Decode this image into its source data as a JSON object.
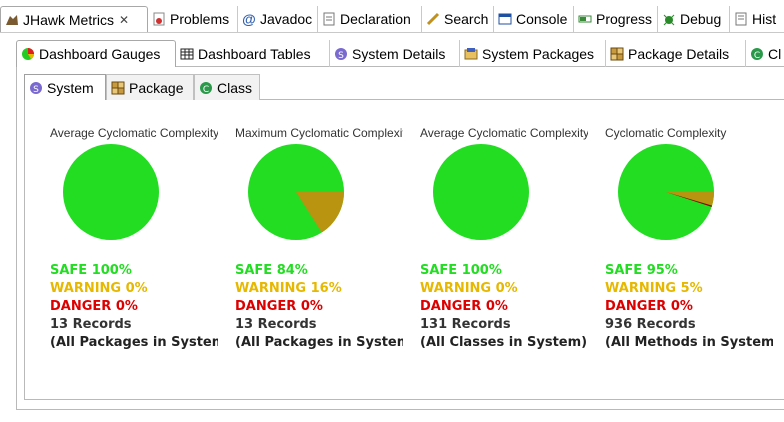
{
  "view_tabs": [
    {
      "label": "JHawk Metrics",
      "icon": "jhawk-icon",
      "active": true,
      "closable": true
    },
    {
      "label": "Problems",
      "icon": "problems-icon"
    },
    {
      "label": "Javadoc",
      "icon": "javadoc-icon"
    },
    {
      "label": "Declaration",
      "icon": "declaration-icon"
    },
    {
      "label": "Search",
      "icon": "search-icon"
    },
    {
      "label": "Console",
      "icon": "console-icon"
    },
    {
      "label": "Progress",
      "icon": "progress-icon"
    },
    {
      "label": "Debug",
      "icon": "debug-icon"
    },
    {
      "label": "Hist",
      "icon": "history-icon"
    }
  ],
  "main_tabs": [
    {
      "label": "Dashboard Gauges",
      "icon": "gauge-icon",
      "active": true
    },
    {
      "label": "Dashboard Tables",
      "icon": "table-icon"
    },
    {
      "label": "System Details",
      "icon": "system-icon"
    },
    {
      "label": "System Packages",
      "icon": "packages-icon"
    },
    {
      "label": "Package Details",
      "icon": "package-icon"
    },
    {
      "label": "Cl",
      "icon": "class-icon"
    }
  ],
  "sub_tabs": [
    {
      "label": "System",
      "icon": "system-icon",
      "active": true
    },
    {
      "label": "Package",
      "icon": "package-icon"
    },
    {
      "label": "Class",
      "icon": "class-icon"
    }
  ],
  "colors": {
    "safe": "#22dd22",
    "warning": "#e6b800",
    "danger": "#dd0000",
    "pie_safe": "#22dd22",
    "pie_warning": "#b89410",
    "pie_danger": "#8b0000"
  },
  "gauges": [
    {
      "title": "Average Cyclomatic Complexity",
      "safe": "SAFE 100%",
      "warning": "WARNING 0%",
      "danger": "DANGER 0%",
      "records": "13 Records",
      "scope": "(All Packages in System)",
      "safe_pct": 100,
      "warning_pct": 0,
      "danger_pct": 0
    },
    {
      "title": "Maximum Cyclomatic Complexity",
      "safe": "SAFE 84%",
      "warning": "WARNING 16%",
      "danger": "DANGER 0%",
      "records": "13 Records",
      "scope": "(All Packages in System)",
      "safe_pct": 84,
      "warning_pct": 16,
      "danger_pct": 0
    },
    {
      "title": "Average Cyclomatic Complexity",
      "safe": "SAFE 100%",
      "warning": "WARNING 0%",
      "danger": "DANGER 0%",
      "records": "131 Records",
      "scope": "(All Classes in System)",
      "safe_pct": 100,
      "warning_pct": 0,
      "danger_pct": 0
    },
    {
      "title": "Cyclomatic Complexity",
      "safe": "SAFE 95%",
      "warning": "WARNING 5%",
      "danger": "DANGER 0%",
      "records": "936 Records",
      "scope": "(All Methods in System)",
      "safe_pct": 95,
      "warning_pct": 4.6,
      "danger_pct": 0.4
    }
  ]
}
